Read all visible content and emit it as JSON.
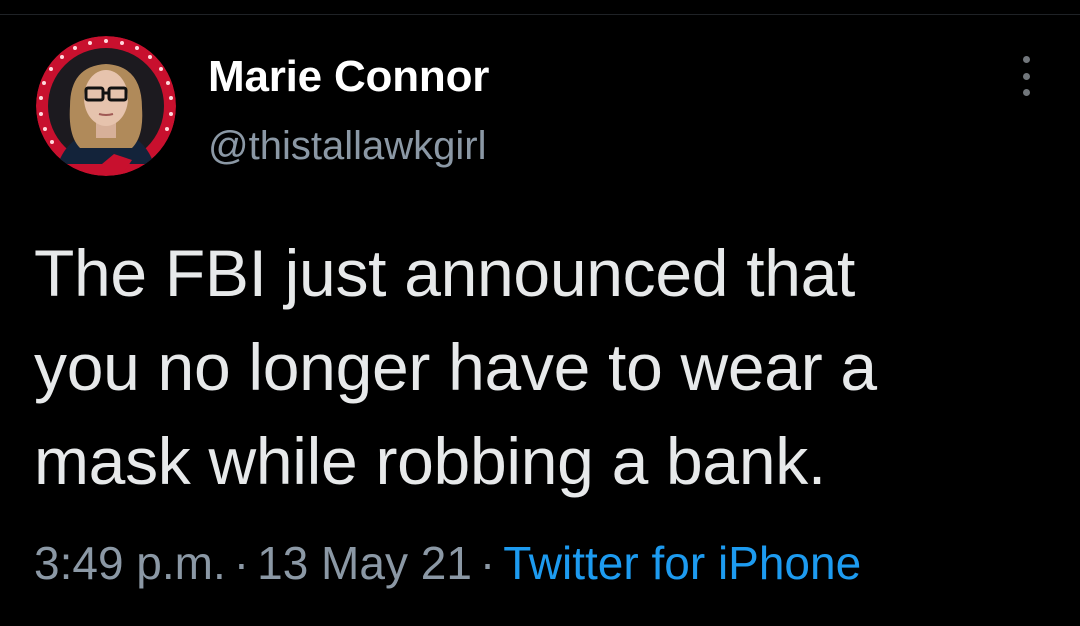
{
  "user": {
    "display_name": "Marie Connor",
    "handle": "@thistallawkgirl"
  },
  "tweet": {
    "text_lines": [
      "The FBI just announced that",
      "you no longer have to wear a",
      "mask while robbing a bank."
    ],
    "time": "3:49 p.m.",
    "date": "13 May 21",
    "separator": "·",
    "source": "Twitter for iPhone"
  },
  "icons": {
    "more": "more-vertical-icon",
    "avatar": "avatar"
  },
  "colors": {
    "background": "#000000",
    "name": "#ffffff",
    "text": "#e7e9ea",
    "secondary": "#8b98a5",
    "link": "#1d9bf0",
    "avatar_ring": "#c8102e"
  }
}
